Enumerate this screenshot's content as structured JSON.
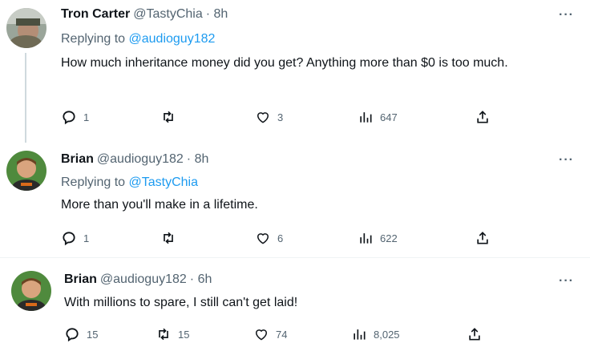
{
  "tweets": [
    {
      "name": "Tron Carter",
      "handle": "@TastyChia",
      "time": "· 8h",
      "reply_prefix": "Replying to ",
      "reply_to": "@audioguy182",
      "text": "How much inheritance money did you get? Anything more than $0 is too much.",
      "replies": "1",
      "retweets": "",
      "likes": "3",
      "views": "647"
    },
    {
      "name": "Brian",
      "handle": "@audioguy182",
      "time": "· 8h",
      "reply_prefix": "Replying to ",
      "reply_to": "@TastyChia",
      "text": "More than you'll make in a lifetime.",
      "replies": "1",
      "retweets": "",
      "likes": "6",
      "views": "622"
    },
    {
      "name": "Brian",
      "handle": "@audioguy182",
      "time": "· 6h",
      "text": "With millions to spare, I still can't get laid!",
      "replies": "15",
      "retweets": "15",
      "likes": "74",
      "views": "8,025"
    }
  ],
  "more_label": "···",
  "colors": {
    "accent": "#1d9bf0",
    "muted": "#536471",
    "text": "#0f1419"
  }
}
